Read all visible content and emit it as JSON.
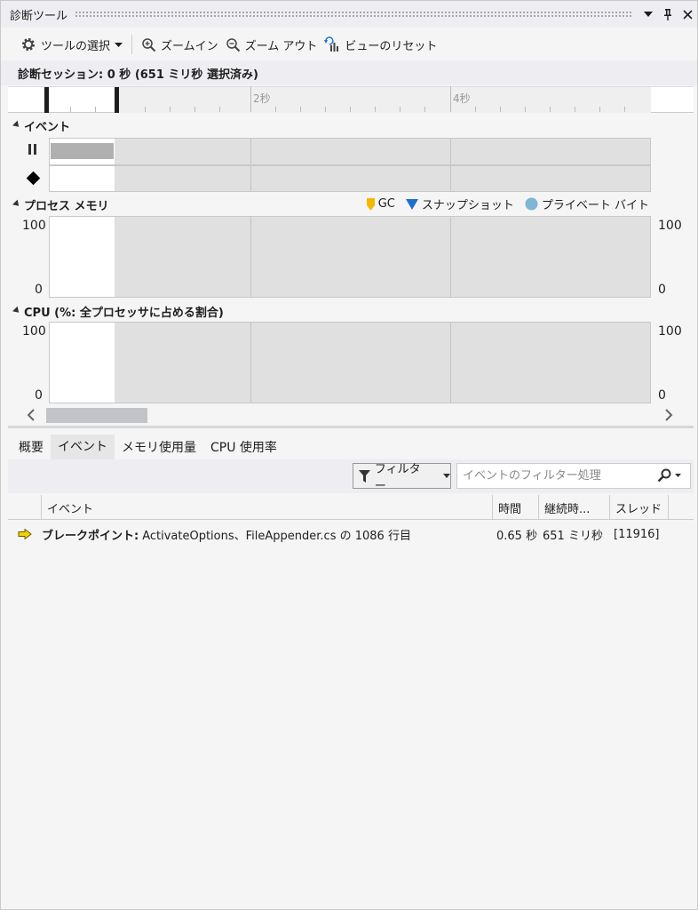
{
  "window": {
    "title": "診断ツール"
  },
  "toolbar": {
    "tools_select": "ツールの選択",
    "zoom_in": "ズームイン",
    "zoom_out": "ズーム アウト",
    "reset_view": "ビューのリセット"
  },
  "session": {
    "label": "診断セッション: 0 秒 (651 ミリ秒 選択済み)"
  },
  "ruler": {
    "labels": [
      "2秒",
      "4秒"
    ]
  },
  "events": {
    "header": "イベント"
  },
  "memory": {
    "header": "プロセス メモリ",
    "legend": {
      "gc": "GC",
      "snapshot": "スナップショット",
      "private": "プライベート バイト"
    },
    "y_max": "100",
    "y_min": "0",
    "y_max_right": "100",
    "y_min_right": "0"
  },
  "cpu": {
    "header": "CPU (%: 全プロセッサに占める割合)",
    "y_max": "100",
    "y_min": "0",
    "y_max_right": "100",
    "y_min_right": "0"
  },
  "tabs": [
    "概要",
    "イベント",
    "メモリ使用量",
    "CPU 使用率"
  ],
  "filter": {
    "label": "フィルター",
    "placeholder": "イベントのフィルター処理"
  },
  "grid": {
    "columns": [
      "イベント",
      "時間",
      "継続時...",
      "スレッド"
    ],
    "rows": [
      {
        "type": "ブレークポイント:",
        "desc": "ActivateOptions、FileAppender.cs の 1086 行目",
        "time": "0.65 秒",
        "duration": "651 ミリ秒",
        "thread": "[11916]"
      }
    ]
  },
  "colors": {
    "gc": "#f5b800",
    "snapshot": "#1e6fd0",
    "private": "#7eb6d4",
    "breakpoint": "#f5d000"
  }
}
